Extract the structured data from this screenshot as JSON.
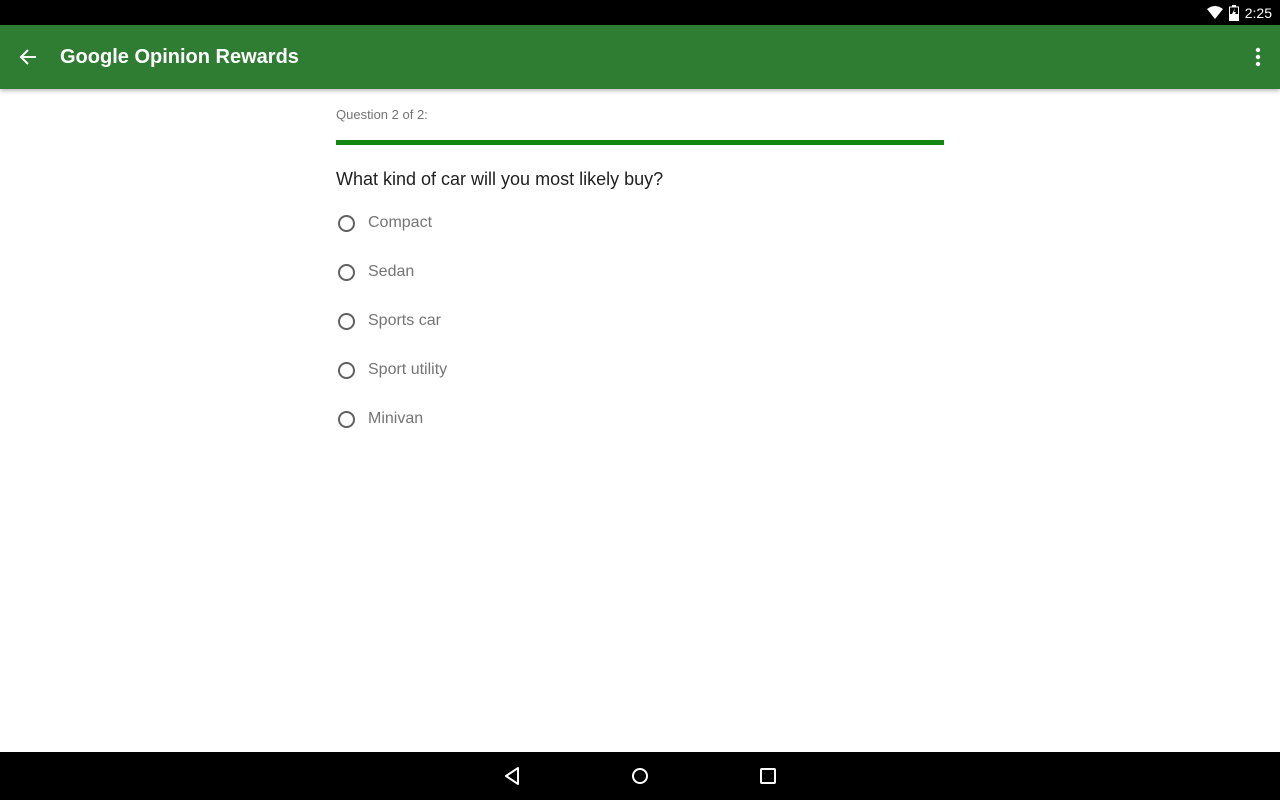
{
  "status_bar": {
    "time": "2:25",
    "icons": [
      "wifi-icon",
      "battery-charging-icon"
    ]
  },
  "app_bar": {
    "title": "Google Opinion Rewards",
    "back_icon": "arrow-back-icon",
    "menu_icon": "more-vert-icon",
    "color": "#2e7d32"
  },
  "survey": {
    "counter": "Question 2 of 2:",
    "progress_percent": 100,
    "progress_color": "#12870f",
    "question": "What kind of car will you most likely buy?",
    "options": [
      {
        "label": "Compact",
        "selected": false
      },
      {
        "label": "Sedan",
        "selected": false
      },
      {
        "label": "Sports car",
        "selected": false
      },
      {
        "label": "Sport utility",
        "selected": false
      },
      {
        "label": "Minivan",
        "selected": false
      }
    ]
  },
  "nav_bar": {
    "buttons": [
      "back-triangle-icon",
      "home-circle-icon",
      "recents-square-icon"
    ]
  }
}
